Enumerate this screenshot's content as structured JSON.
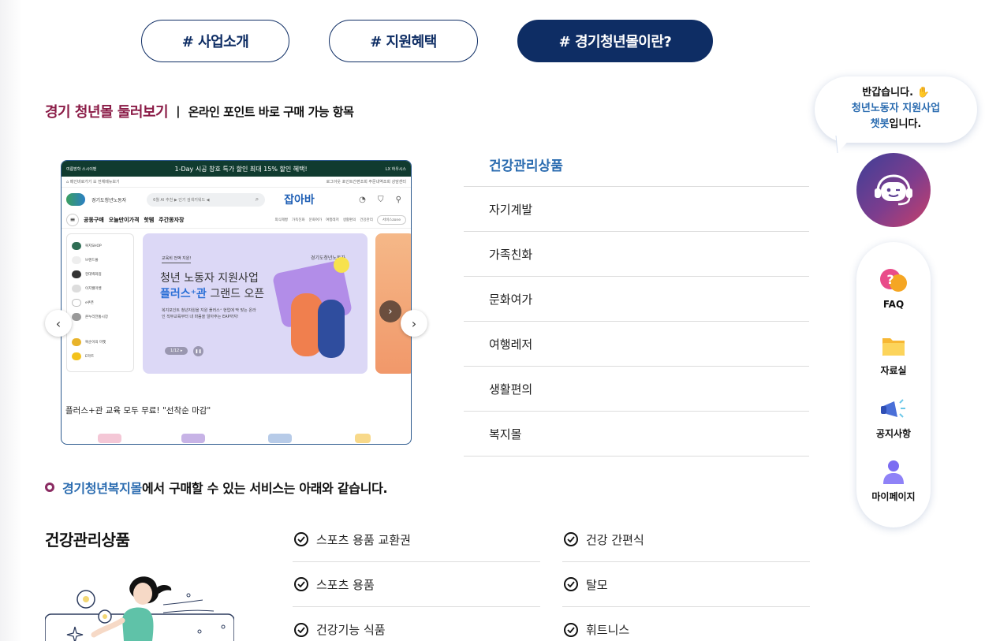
{
  "tabs": [
    {
      "label": "# 사업소개",
      "active": false
    },
    {
      "label": "# 지원혜택",
      "active": false
    },
    {
      "label": "# 경기청년몰이란?",
      "active": true
    }
  ],
  "heading": {
    "main": "경기 청년몰 둘러보기",
    "separator": "|",
    "sub": "온라인 포인트 바로 구매 가능 항목"
  },
  "preview": {
    "top_bar": {
      "left_badge": "여름방학 스시이벤",
      "promo": "1-Day 시공 창호 특가 할인  최대 15% 할인 혜택!",
      "brand": "LX 하우시스"
    },
    "crumb_left": "⌂ 메인바로가기   ☰ 전체메뉴보기",
    "crumb_right": "로그아웃   포인트간편조회   주문내역조회   상담센터",
    "logo_text": "경기도청년노동자",
    "search_placeholder": "6월 AI 추천 ▶ 인기 검색키워드 ◀",
    "jab_logo": "잡아바",
    "nav": [
      "공동구매",
      "오늘만이가격",
      "핫템",
      "주간몽자장"
    ],
    "nav_small": [
      "외식제빵",
      "가족친화",
      "문화여가",
      "여행레저",
      "생활편의",
      "건강관리"
    ],
    "service_select": "서비스zone",
    "side_shops": [
      "복지SHOP",
      "브랜드몰",
      "현대백화점",
      "이지웰마켓",
      "e쿠폰",
      "온누리전통시장",
      "복순이의 마켓",
      "E마트"
    ],
    "banner": {
      "label": "교육비 전액 지원!",
      "line1": "청년 노동자 지원사업",
      "line2_blue": "플러스⁺관",
      "line2_rest": " 그랜드 오픈",
      "desc": "복지포인트 청년자원을 지원 플러스⁺ 현업에 딱 맞는 온라인 직무교육부터 내 마음을 알아주는 EAP까지!",
      "page": "1/12 ▸",
      "logo": "경기도청년노동자"
    },
    "caption": "플러스+관 교육 모두 무료! \"선착순 마감\""
  },
  "categories": [
    {
      "label": "건강관리상품",
      "active": true
    },
    {
      "label": "자기계발",
      "active": false
    },
    {
      "label": "가족친화",
      "active": false
    },
    {
      "label": "문화여가",
      "active": false
    },
    {
      "label": "여행레저",
      "active": false
    },
    {
      "label": "생활편의",
      "active": false
    },
    {
      "label": "복지몰",
      "active": false
    }
  ],
  "info": {
    "highlight": "경기청년복지몰",
    "rest": "에서 구매할 수 있는 서비스는 아래와 같습니다."
  },
  "section": {
    "title": "건강관리상품",
    "col1": [
      "스포츠 용품 교환권",
      "스포츠 용품",
      "건강기능 식품"
    ],
    "col2": [
      "건강 간편식",
      "탈모",
      "휘트니스"
    ]
  },
  "chatbot": {
    "line1": "반갑습니다.",
    "line2": "청년노동자 지원사업",
    "line3_blue": "챗봇",
    "line3_rest": "입니다."
  },
  "quick_menu": [
    "FAQ",
    "자료실",
    "공지사항",
    "마이페이지"
  ],
  "colors": {
    "navy": "#0e2d64",
    "accent": "#8b1c47",
    "blue": "#2b6cb0",
    "purple": "#8b2c63"
  }
}
